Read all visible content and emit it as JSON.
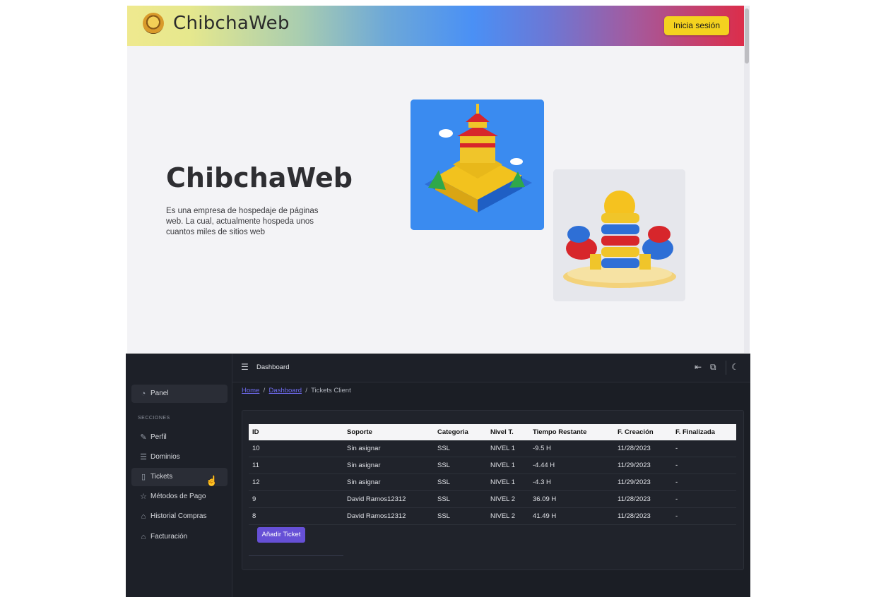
{
  "landing": {
    "brand": "ChibchaWeb",
    "login_button": "Inicia sesión",
    "hero_title": "ChibchaWeb",
    "hero_description": "Es una empresa de hospedaje de páginas web. La cual, actualmente hospeda unos cuantos miles de sitios web"
  },
  "dashboard": {
    "topbar_title": "Dashboard",
    "sidebar": {
      "panel": "Panel",
      "section_label": "SECCIONES",
      "items": [
        {
          "label": "Perfil",
          "icon": "pencil-icon"
        },
        {
          "label": "Dominios",
          "icon": "list-icon"
        },
        {
          "label": "Tickets",
          "icon": "clipboard-icon"
        },
        {
          "label": "Métodos de Pago",
          "icon": "star-icon"
        },
        {
          "label": "Historial Compras",
          "icon": "bank-icon"
        },
        {
          "label": "Facturación",
          "icon": "bank-icon"
        }
      ]
    },
    "breadcrumb": {
      "home": "Home",
      "dashboard": "Dashboard",
      "current": "Tickets Client"
    },
    "table": {
      "columns": [
        "ID",
        "Soporte",
        "Categoria",
        "Nivel T.",
        "Tiempo Restante",
        "F. Creación",
        "F. Finalizada"
      ],
      "rows": [
        [
          "10",
          "Sin asignar",
          "SSL",
          "NIVEL 1",
          "-9.5 H",
          "11/28/2023",
          "-"
        ],
        [
          "11",
          "Sin asignar",
          "SSL",
          "NIVEL 1",
          "-4.44 H",
          "11/29/2023",
          "-"
        ],
        [
          "12",
          "Sin asignar",
          "SSL",
          "NIVEL 1",
          "-4.3 H",
          "11/29/2023",
          "-"
        ],
        [
          "9",
          "David Ramos12312",
          "SSL",
          "NIVEL 2",
          "36.09 H",
          "11/28/2023",
          "-"
        ],
        [
          "8",
          "David Ramos12312",
          "SSL",
          "NIVEL 2",
          "41.49 H",
          "11/28/2023",
          "-"
        ]
      ]
    },
    "add_ticket_button": "Añadir Ticket",
    "colors": {
      "accent": "#6650d6",
      "link": "#6f6cf0",
      "login": "#f4d21f"
    }
  }
}
